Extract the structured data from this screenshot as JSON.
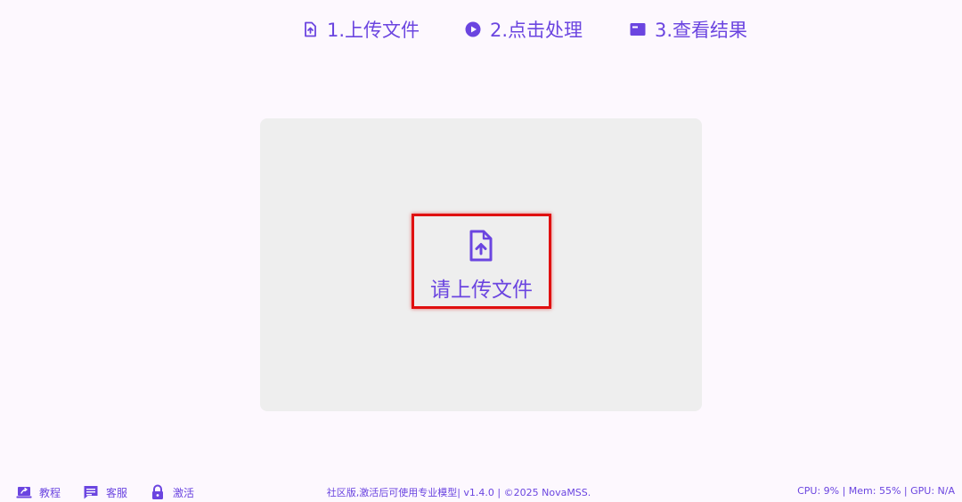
{
  "header": {
    "steps": [
      {
        "label": "1.上传文件",
        "icon": "file-upload-icon"
      },
      {
        "label": "2.点击处理",
        "icon": "play-circle-icon"
      },
      {
        "label": "3.查看结果",
        "icon": "result-card-icon"
      }
    ],
    "logo_icon": "audio-waveform-logo-icon"
  },
  "main": {
    "upload_label": "请上传文件",
    "upload_icon": "file-upload-icon"
  },
  "footer": {
    "links": [
      {
        "label": "教程",
        "icon": "tutorial-icon"
      },
      {
        "label": "客服",
        "icon": "chat-icon"
      },
      {
        "label": "激活",
        "icon": "lock-icon"
      }
    ],
    "edition_text": "社区版,激活后可使用专业模型| v1.4.0 | ©2025 NovaMSS.",
    "system_stats": "CPU: 9% | Mem: 55% | GPU: N/A"
  },
  "colors": {
    "accent": "#6b45e0",
    "background": "#fdf8fe",
    "dropzone": "#eeeeee",
    "highlight": "#e01010"
  }
}
